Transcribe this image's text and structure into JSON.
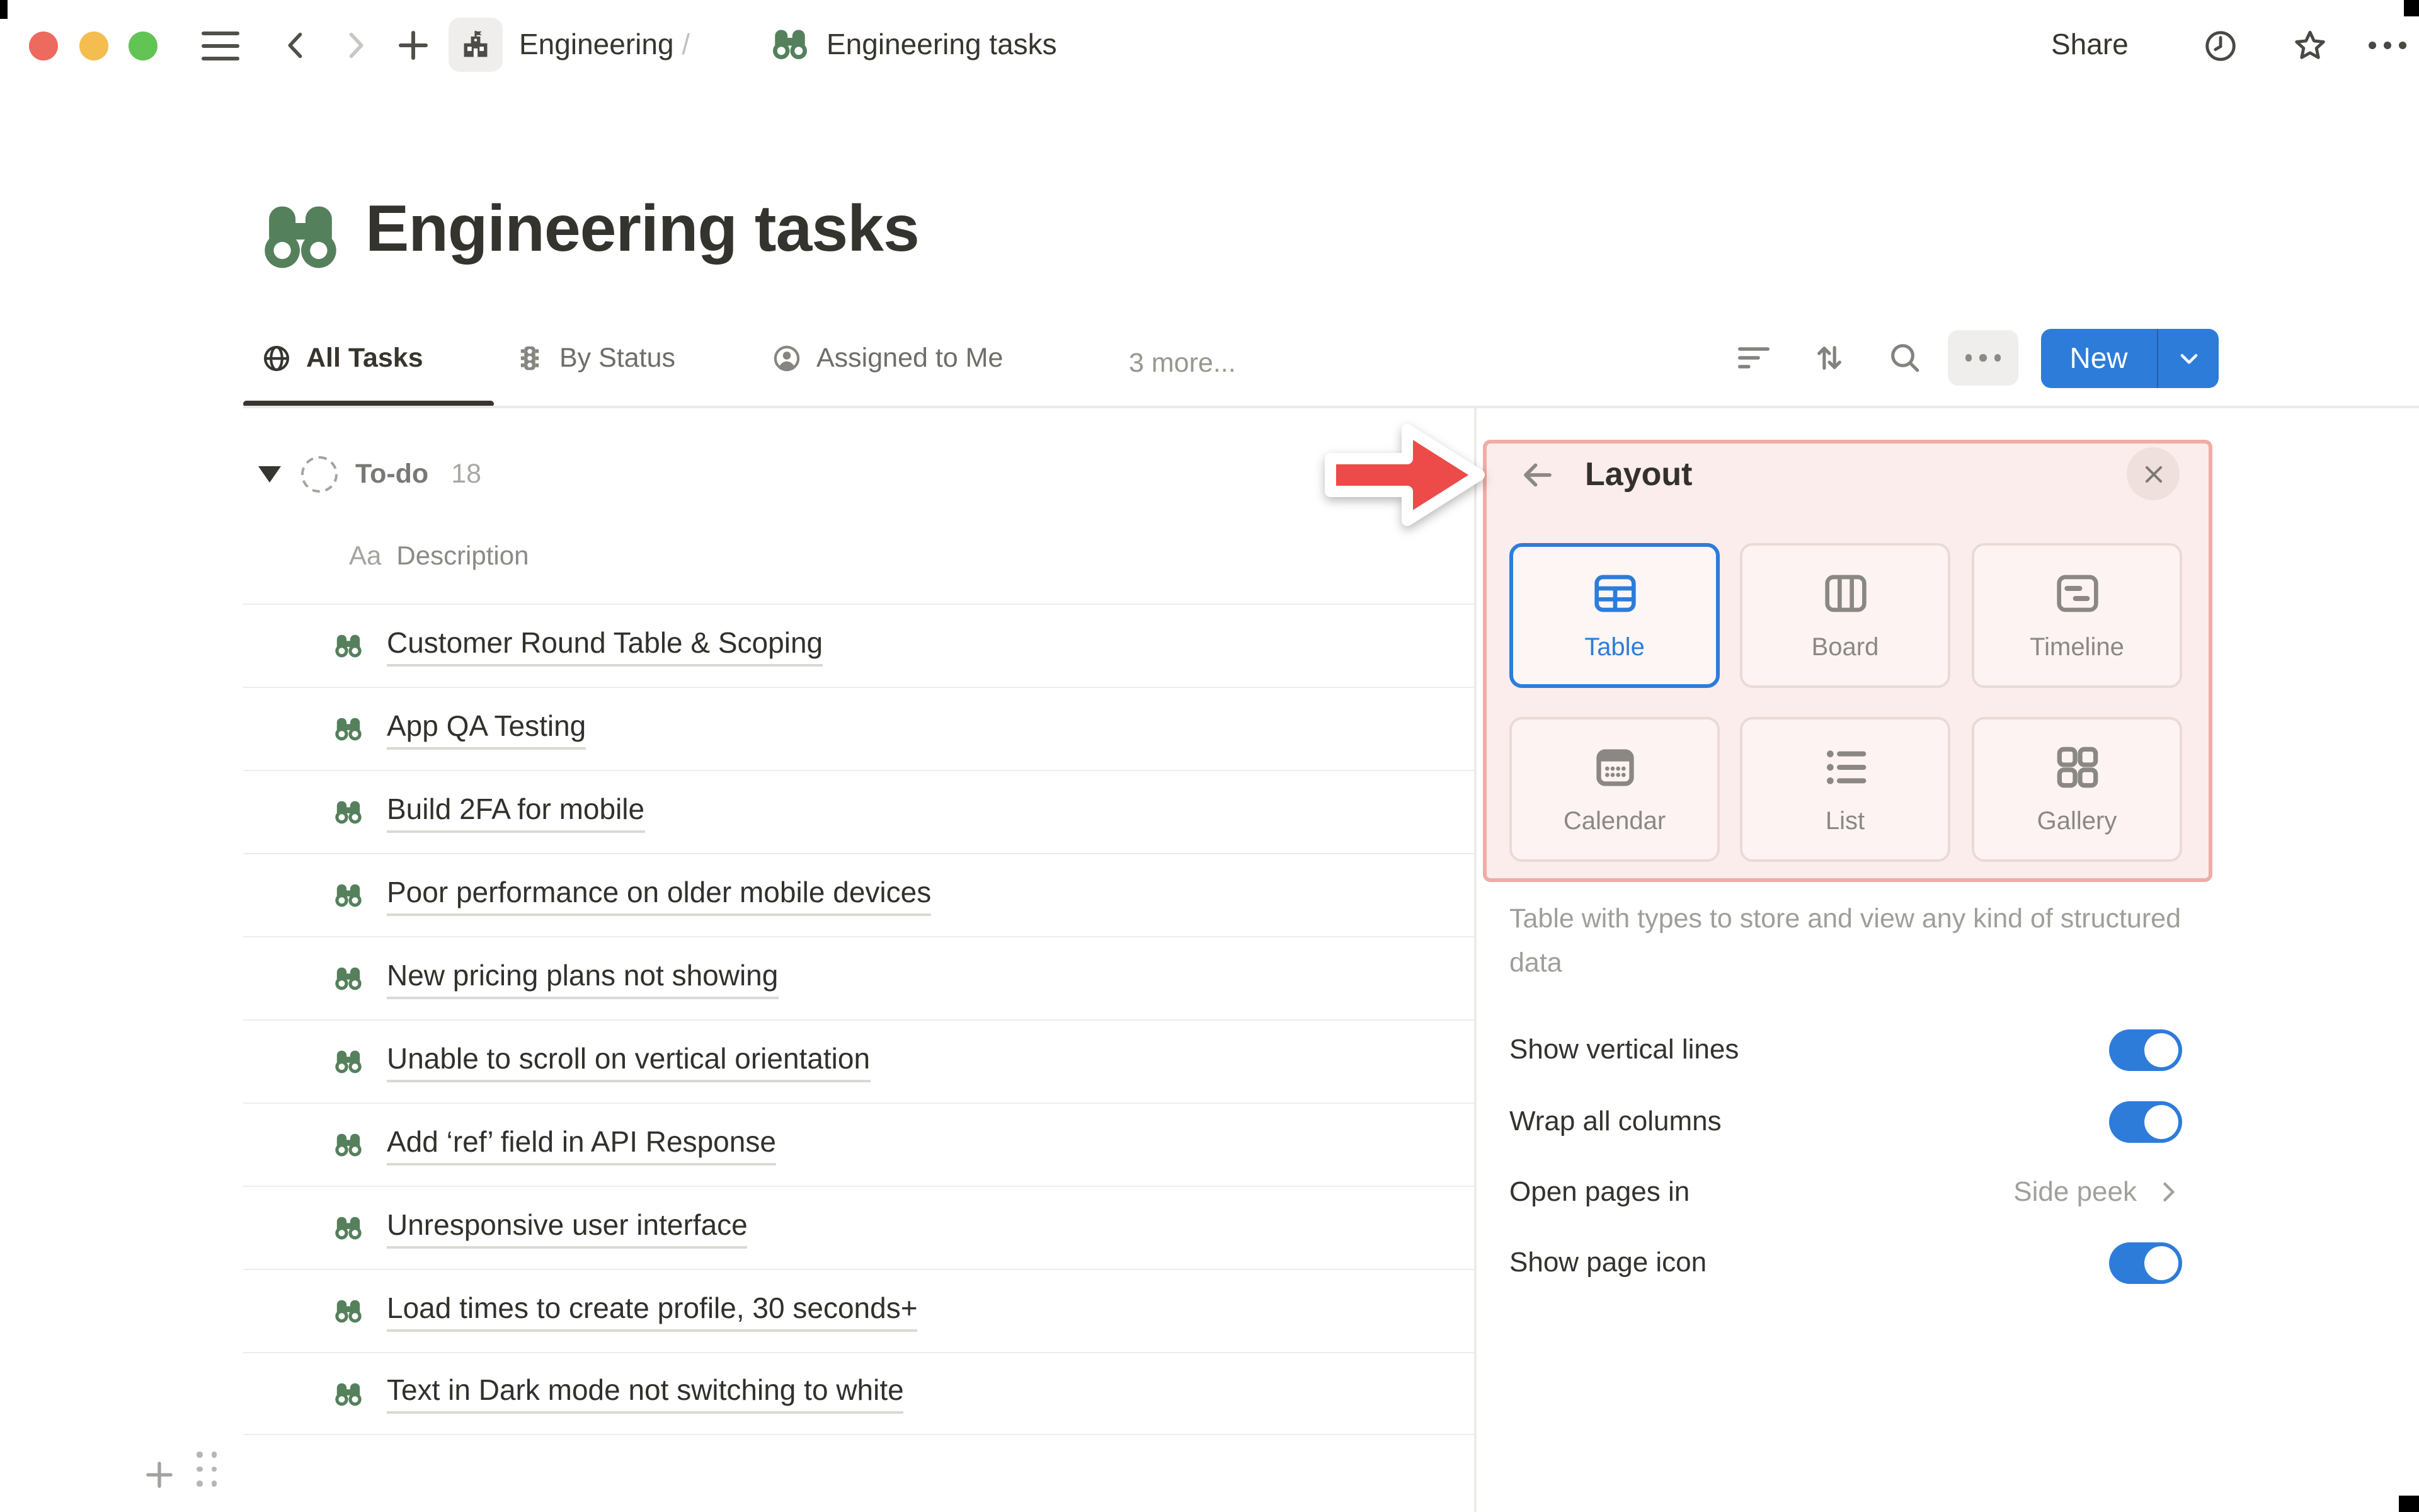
{
  "window": {
    "traffic_lights": [
      "#EC6A5E",
      "#F5BD4F",
      "#61C454"
    ]
  },
  "topbar": {
    "breadcrumb": {
      "section": "Engineering",
      "separator": "/",
      "page": "Engineering tasks"
    },
    "share_label": "Share"
  },
  "page": {
    "title": "Engineering tasks"
  },
  "tabs": {
    "items": [
      {
        "label": "All Tasks",
        "active": true
      },
      {
        "label": "By Status",
        "active": false
      },
      {
        "label": "Assigned to Me",
        "active": false
      }
    ],
    "more_label": "3 more..."
  },
  "toolbar": {
    "new_label": "New"
  },
  "table": {
    "group": {
      "name": "To-do",
      "count": "18"
    },
    "column": {
      "type_label": "Aa",
      "name": "Description"
    },
    "rows": [
      "Customer Round Table & Scoping",
      "App QA Testing",
      "Build 2FA for mobile",
      "Poor performance on older mobile devices",
      "New pricing plans not showing",
      "Unable to scroll on vertical orientation",
      "Add ‘ref’ field in API Response",
      "Unresponsive user interface",
      "Load times to create profile, 30 seconds+",
      "Text in Dark mode not switching to white"
    ]
  },
  "panel": {
    "title": "Layout",
    "layouts": [
      {
        "label": "Table",
        "selected": true
      },
      {
        "label": "Board",
        "selected": false
      },
      {
        "label": "Timeline",
        "selected": false
      },
      {
        "label": "Calendar",
        "selected": false
      },
      {
        "label": "List",
        "selected": false
      },
      {
        "label": "Gallery",
        "selected": false
      }
    ],
    "description": "Table with types to store and view any kind of structured data",
    "settings": [
      {
        "label": "Show vertical lines",
        "type": "toggle",
        "value": true
      },
      {
        "label": "Wrap all columns",
        "type": "toggle",
        "value": true
      },
      {
        "label": "Open pages in",
        "type": "link",
        "value": "Side peek"
      },
      {
        "label": "Show page icon",
        "type": "toggle",
        "value": true
      }
    ]
  },
  "colors": {
    "accent_blue": "#2E7CD9",
    "icon_green": "#55805C",
    "annotation_red": "#EC4B49",
    "annotation_pink_bg": "#FBEDEB",
    "annotation_pink_border": "#F0ACA6"
  }
}
